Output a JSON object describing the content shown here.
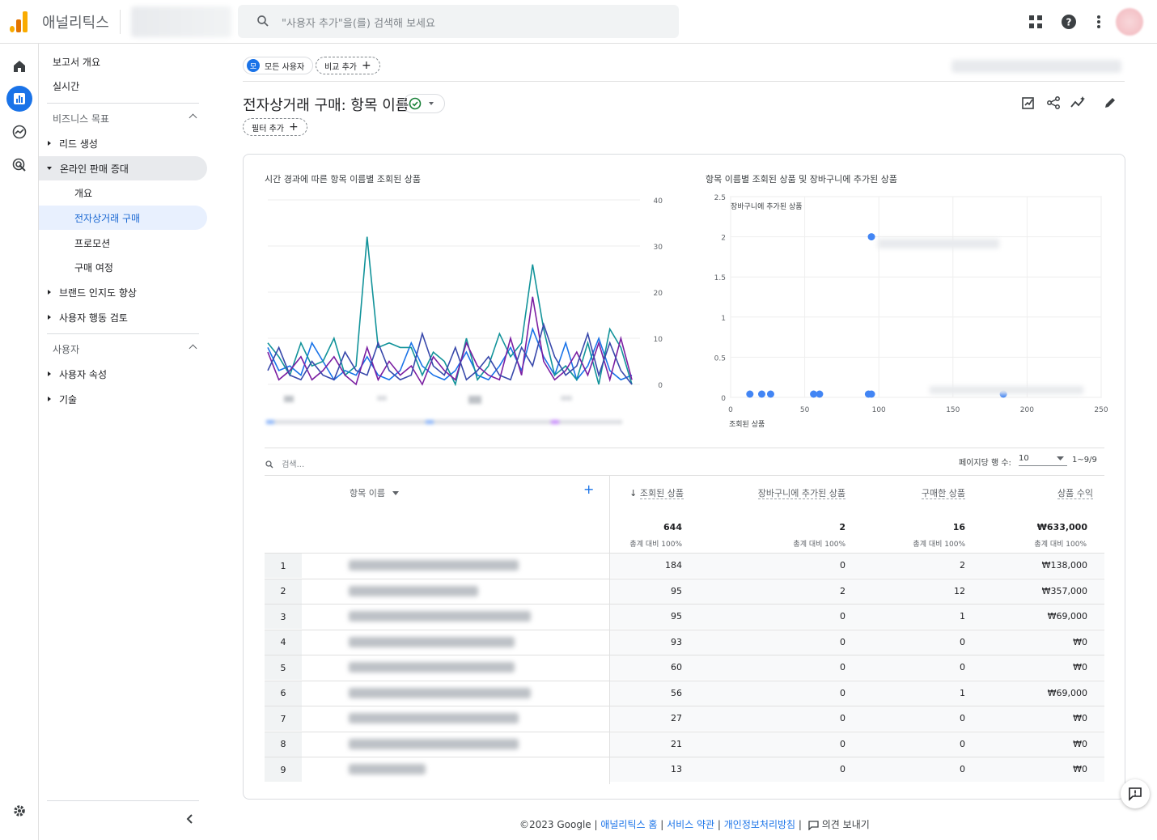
{
  "app": {
    "title": "애널리틱스"
  },
  "search": {
    "placeholder": "\"사용자 추가\"을(를) 검색해 보세요"
  },
  "nav": {
    "overview": "보고서 개요",
    "realtime": "실시간",
    "business_goals": "비즈니스 목표",
    "items": [
      {
        "label": "리드 생성"
      },
      {
        "label": "온라인 판매 증대"
      },
      {
        "label": "개요"
      },
      {
        "label": "전자상거래 구매"
      },
      {
        "label": "프로모션"
      },
      {
        "label": "구매 여정"
      },
      {
        "label": "브랜드 인지도 향상"
      },
      {
        "label": "사용자 행동 검토"
      }
    ],
    "users_section": "사용자",
    "user_items": [
      {
        "label": "사용자 속성"
      },
      {
        "label": "기술"
      }
    ]
  },
  "chips": {
    "all_users": "모든 사용자",
    "compare_add": "비교 추가",
    "filter_add": "필터 추가",
    "badge": "모"
  },
  "page": {
    "title": "전자상거래 구매: 항목 이름"
  },
  "line_chart": {
    "title": "시간 경과에 따른 항목 이름별 조회된 상품",
    "y_ticks": [
      "40",
      "30",
      "20",
      "10",
      "0"
    ]
  },
  "scatter_chart": {
    "title": "항목 이름별 조회된 상품 및 장바구니에 추가된 상품",
    "y_label": "장바구니에 추가된 상품",
    "x_label": "조회된 상품",
    "y_ticks": [
      "2.5",
      "2",
      "1.5",
      "1",
      "0.5",
      "0"
    ],
    "x_ticks": [
      "0",
      "50",
      "100",
      "150",
      "200",
      "250"
    ]
  },
  "chart_data": [
    {
      "type": "line",
      "title": "시간 경과에 따른 항목 이름별 조회된 상품",
      "ylim": [
        0,
        40
      ],
      "series": [
        {
          "color": "#1a73e8",
          "values": [
            8,
            3,
            4,
            2,
            9,
            5,
            1,
            3,
            2,
            6,
            2,
            1,
            3,
            9,
            4,
            2,
            1,
            3,
            7,
            2,
            1,
            4,
            8,
            3,
            12,
            6,
            2,
            9,
            1,
            4,
            10,
            3,
            1,
            2
          ]
        },
        {
          "color": "#12939a",
          "values": [
            9,
            6,
            2,
            9,
            4,
            5,
            10,
            2,
            4,
            32,
            8,
            9,
            8,
            8,
            2,
            7,
            5,
            0,
            10,
            1,
            4,
            11,
            6,
            9,
            26,
            12,
            2,
            4,
            1,
            9,
            0,
            12,
            8,
            0
          ]
        },
        {
          "color": "#7b1fa2",
          "values": [
            7,
            1,
            3,
            6,
            1,
            3,
            6,
            2,
            0,
            8,
            1,
            5,
            2,
            4,
            0,
            6,
            3,
            1,
            9,
            4,
            2,
            1,
            10,
            2,
            19,
            5,
            1,
            3,
            7,
            2,
            9,
            1,
            10,
            1
          ]
        },
        {
          "color": "#3949ab",
          "values": [
            3,
            8,
            2,
            1,
            5,
            2,
            1,
            7,
            3,
            2,
            9,
            3,
            1,
            2,
            11,
            4,
            2,
            8,
            1,
            3,
            6,
            2,
            1,
            8,
            4,
            13,
            6,
            2,
            4,
            11,
            2,
            9,
            3,
            0
          ]
        }
      ]
    },
    {
      "type": "scatter",
      "title": "항목 이름별 조회된 상품 및 장바구니에 추가된 상품",
      "xlabel": "조회된 상품",
      "ylabel": "장바구니에 추가된 상품",
      "xlim": [
        0,
        250
      ],
      "ylim": [
        0,
        2.5
      ],
      "points": [
        [
          13,
          0
        ],
        [
          21,
          0
        ],
        [
          27,
          0
        ],
        [
          56,
          0
        ],
        [
          60,
          0
        ],
        [
          93,
          0
        ],
        [
          95,
          0
        ],
        [
          95,
          2
        ],
        [
          184,
          0
        ]
      ]
    }
  ],
  "table": {
    "search_placeholder": "검색...",
    "rows_per_page_label": "페이지당 행 수:",
    "rows_per_page": "10",
    "range": "1~9/9",
    "headers": {
      "name": "항목 이름",
      "views": "조회된 상품",
      "carts": "장바구니에 추가된 상품",
      "purchased": "구매한 상품",
      "revenue": "상품 수익"
    },
    "totals": {
      "views": "644",
      "carts": "2",
      "purchased": "16",
      "revenue": "₩633,000"
    },
    "totals_sub": "총계 대비 100%",
    "rows": [
      {
        "idx": "1",
        "views": "184",
        "carts": "0",
        "purchased": "2",
        "revenue": "₩138,000"
      },
      {
        "idx": "2",
        "views": "95",
        "carts": "2",
        "purchased": "12",
        "revenue": "₩357,000"
      },
      {
        "idx": "3",
        "views": "95",
        "carts": "0",
        "purchased": "1",
        "revenue": "₩69,000"
      },
      {
        "idx": "4",
        "views": "93",
        "carts": "0",
        "purchased": "0",
        "revenue": "₩0"
      },
      {
        "idx": "5",
        "views": "60",
        "carts": "0",
        "purchased": "0",
        "revenue": "₩0"
      },
      {
        "idx": "6",
        "views": "56",
        "carts": "0",
        "purchased": "1",
        "revenue": "₩69,000"
      },
      {
        "idx": "7",
        "views": "27",
        "carts": "0",
        "purchased": "0",
        "revenue": "₩0"
      },
      {
        "idx": "8",
        "views": "21",
        "carts": "0",
        "purchased": "0",
        "revenue": "₩0"
      },
      {
        "idx": "9",
        "views": "13",
        "carts": "0",
        "purchased": "0",
        "revenue": "₩0"
      }
    ]
  },
  "footer": {
    "copyright": "©2023 Google | ",
    "home": "애널리틱스 홈",
    "sep1": " | ",
    "terms": "서비스 약관",
    "sep2": " | ",
    "privacy": "개인정보처리방침",
    "sep3": " | ",
    "feedback": "의견 보내기"
  }
}
